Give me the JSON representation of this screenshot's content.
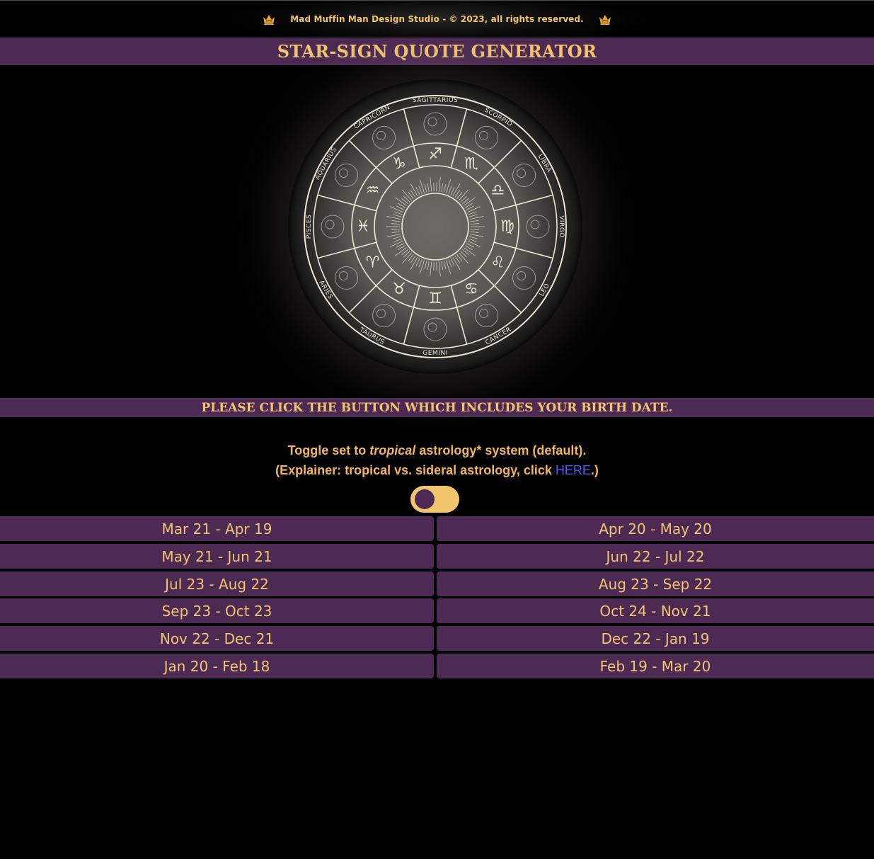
{
  "header": {
    "copyright": "Mad Muffin Man Design Studio - © 2023, all rights reserved.",
    "title": "STAR-SIGN QUOTE GENERATOR"
  },
  "wheel": {
    "signs": [
      "SAGITTARIUS",
      "SCORPIO",
      "LIBRA",
      "VIRGO",
      "LEO",
      "CANCER",
      "GEMINI",
      "TAURUS",
      "ARIES",
      "PISCES",
      "AQUARIUS",
      "CAPRICORN"
    ],
    "glyphs": [
      "♐",
      "♏",
      "♎",
      "♍",
      "♌",
      "♋",
      "♊",
      "♉",
      "♈",
      "♓",
      "♒",
      "♑"
    ]
  },
  "instruction": "PLEASE CLICK THE BUTTON WHICH INCLUDES YOUR BIRTH DATE.",
  "toggle": {
    "line1_prefix": "Toggle set to ",
    "line1_em": "tropical",
    "line1_suffix": " astrology* system (default).",
    "line2_prefix": "(Explainer: tropical vs. sideral astrology, click ",
    "line2_link": "HERE",
    "line2_suffix": ".)",
    "state": "tropical"
  },
  "date_buttons": [
    "Mar 21 - Apr 19",
    "Apr 20 - May 20",
    "May 21 - Jun 21",
    "Jun 22 - Jul 22",
    "Jul 23 - Aug 22",
    "Aug 23 - Sep 22",
    "Sep 23 - Oct 23",
    "Oct 24 - Nov 21",
    "Nov 22 - Dec 21",
    "Dec 22 - Jan 19",
    "Jan 20 - Feb 18",
    "Feb 19 - Mar 20"
  ],
  "colors": {
    "accent": "#4d2a54",
    "gold": "#f2c46e",
    "link": "#4a5cff"
  }
}
